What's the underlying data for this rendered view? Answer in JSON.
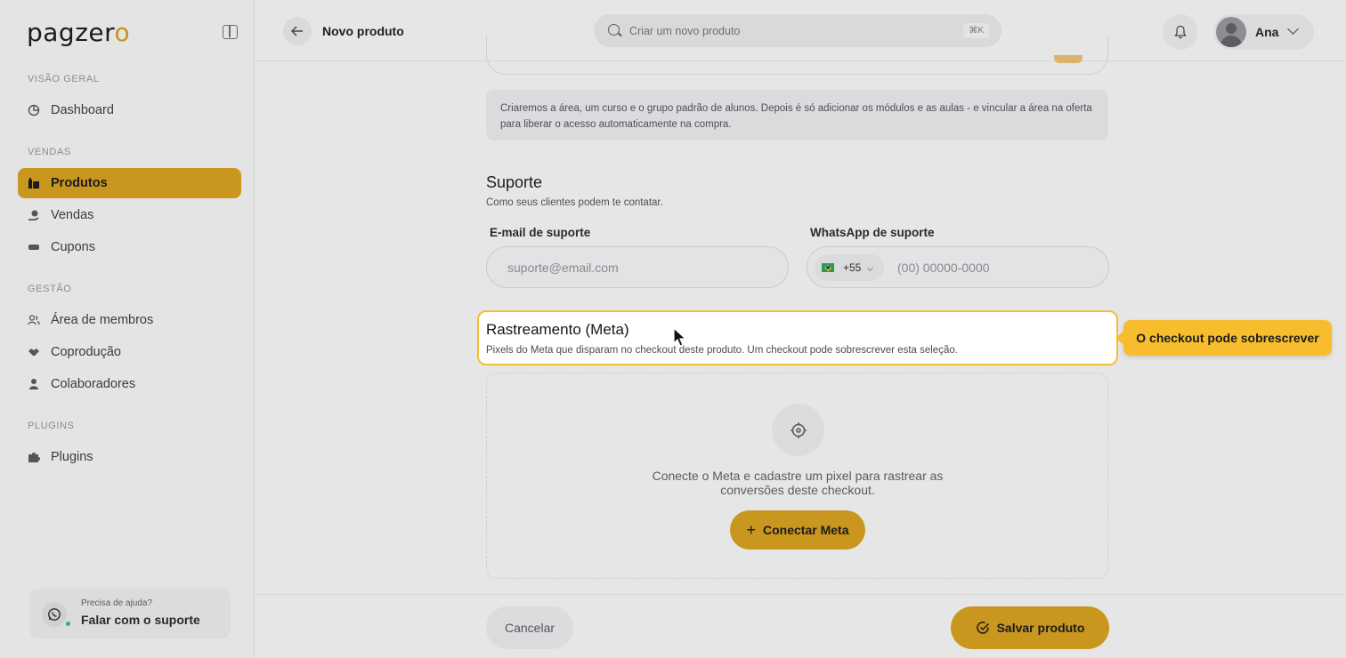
{
  "sidebar": {
    "logo_text": "pagzer",
    "logo_accent": "o",
    "sections": [
      {
        "label": "VISÃO GERAL",
        "items": [
          {
            "label": "Dashboard",
            "icon": "dashboard-icon"
          }
        ]
      },
      {
        "label": "VENDAS",
        "items": [
          {
            "label": "Produtos",
            "icon": "products-icon",
            "active": true
          },
          {
            "label": "Vendas",
            "icon": "sales-icon"
          },
          {
            "label": "Cupons",
            "icon": "coupon-icon"
          }
        ]
      },
      {
        "label": "GESTÃO",
        "items": [
          {
            "label": "Área de membros",
            "icon": "members-icon"
          },
          {
            "label": "Coprodução",
            "icon": "handshake-icon"
          },
          {
            "label": "Colaboradores",
            "icon": "user-icon"
          }
        ]
      },
      {
        "label": "PLUGINS",
        "items": [
          {
            "label": "Plugins",
            "icon": "puzzle-icon"
          }
        ]
      }
    ],
    "help": {
      "small": "Precisa de ajuda?",
      "big": "Falar com o suporte"
    }
  },
  "header": {
    "title": "Novo produto",
    "search_placeholder": "Criar um novo produto",
    "shortcut": "⌘K",
    "user_name": "Ana"
  },
  "main": {
    "info_text": "Criaremos a área, um curso e o grupo padrão de alunos. Depois é só adicionar os módulos e as aulas - e vincular a área na oferta para liberar o acesso automaticamente na compra.",
    "support": {
      "title": "Suporte",
      "subtitle": "Como seus clientes podem te contatar.",
      "email_label": "E-mail de suporte",
      "email_placeholder": "suporte@email.com",
      "whatsapp_label": "WhatsApp de suporte",
      "country_code": "+55",
      "phone_placeholder": "(00) 00000-0000"
    },
    "tracking": {
      "title": "Rastreamento (Meta)",
      "subtitle": "Pixels do Meta que disparam no checkout deste produto. Um checkout pode sobrescrever esta seleção.",
      "tooltip": "O checkout pode sobrescrever",
      "empty_text": "Conecte o Meta e cadastre um pixel para rastrear as conversões deste checkout.",
      "connect_label": "Conectar Meta"
    }
  },
  "footer": {
    "cancel_label": "Cancelar",
    "save_label": "Salvar produto"
  },
  "colors": {
    "accent": "#c9961e",
    "highlight_border": "#f2bf34",
    "tooltip_bg": "#f7bd2c"
  }
}
